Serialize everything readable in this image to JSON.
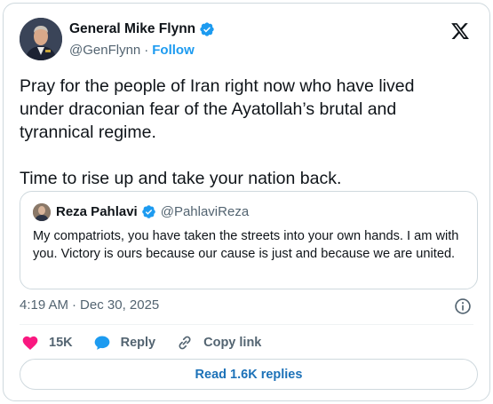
{
  "author": {
    "name": "General Mike Flynn",
    "handle": "@GenFlynn",
    "separator": "·",
    "follow_label": "Follow"
  },
  "tweet": {
    "text": "Pray for the people of Iran right now who have lived\nunder draconian fear of the Ayatollah’s brutal and\ntyrannical regime.\n\nTime to rise up and take your nation back."
  },
  "quote": {
    "name": "Reza Pahlavi",
    "handle": "@PahlaviReza",
    "text": "My compatriots, you have taken the streets into your own hands. I am with you. Victory is ours because our cause is just and because we are united."
  },
  "meta": {
    "time": "4:19 AM",
    "separator": "·",
    "date": "Dec 30, 2025"
  },
  "actions": {
    "like_count": "15K",
    "reply_label": "Reply",
    "copy_link_label": "Copy link"
  },
  "replies_button": "Read 1.6K replies",
  "colors": {
    "accent": "#1d9bf0",
    "like": "#f91880",
    "text": "#0f1419",
    "muted": "#536471",
    "border": "#cfd9de"
  },
  "icons": [
    "verified-badge-icon",
    "x-logo-icon",
    "info-icon",
    "heart-icon",
    "reply-bubble-icon",
    "link-icon"
  ]
}
